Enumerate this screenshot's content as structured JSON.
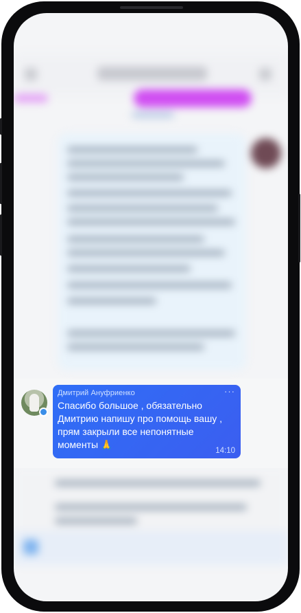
{
  "message": {
    "sender": "Дмитрий Ануфриенко",
    "lines": [
      "Спасибо большое , обязательно",
      "Дмитрию напишу про помощь вашу ,",
      "прям закрыли все непонятные",
      "моменты 🙏"
    ],
    "time": "14:10",
    "more_glyph": "···",
    "verified_badge_icon": "verified-icon"
  },
  "colors": {
    "bubble": "#3166f5",
    "phone_frame": "#0b0b0d"
  }
}
